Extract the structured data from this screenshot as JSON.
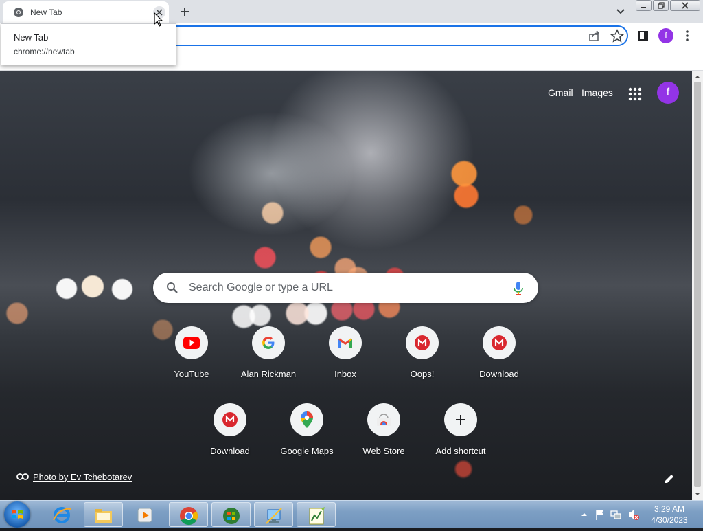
{
  "tab": {
    "title": "New Tab"
  },
  "tooltip": {
    "title": "New Tab",
    "url": "chrome://newtab"
  },
  "toolbar": {
    "avatar_letter": "f"
  },
  "ntp": {
    "gmail": "Gmail",
    "images": "Images",
    "avatar_letter": "f",
    "search_placeholder": "Search Google or type a URL",
    "shortcuts": [
      {
        "label": "YouTube",
        "icon": "youtube-icon"
      },
      {
        "label": "Alan Rickman",
        "icon": "google-icon"
      },
      {
        "label": "Inbox",
        "icon": "gmail-icon"
      },
      {
        "label": "Oops!",
        "icon": "mega-icon"
      },
      {
        "label": "Download",
        "icon": "mega-icon"
      },
      {
        "label": "Download",
        "icon": "mega-icon"
      },
      {
        "label": "Google Maps",
        "icon": "google-maps-icon"
      },
      {
        "label": "Web Store",
        "icon": "web-store-icon"
      },
      {
        "label": "Add shortcut",
        "icon": "plus-icon"
      }
    ],
    "photo_credit": "Photo by Ev Tchebotarev"
  },
  "taskbar": {
    "items": [
      "internet-explorer-icon",
      "file-explorer-icon",
      "media-player-icon",
      "chrome-icon",
      "windows-update-icon",
      "network-icon",
      "chart-app-icon"
    ],
    "time": "3:29 AM",
    "date": "4/30/2023"
  },
  "colors": {
    "accent": "#1a73e8",
    "avatar": "#9334e6",
    "taskbar": "#7d9fc4"
  }
}
